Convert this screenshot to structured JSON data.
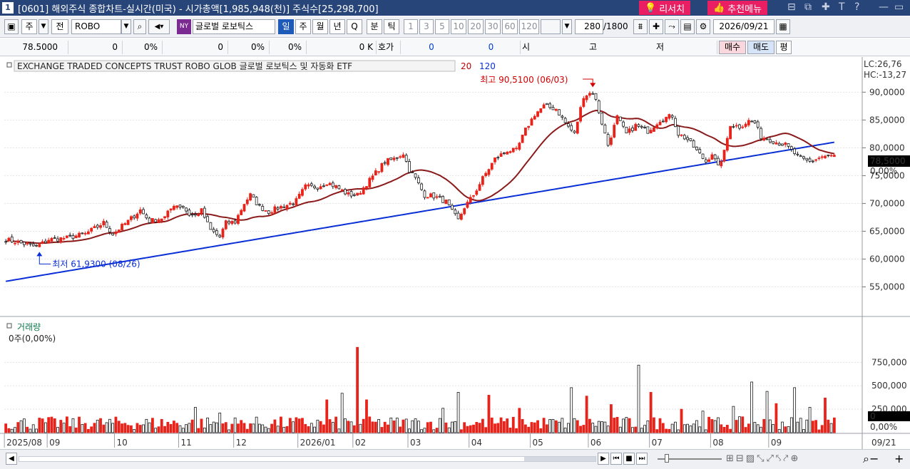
{
  "window": {
    "number": "1",
    "title": "[0601] 해외주식 종합차트-실시간(미국) - 시가총액[1,985,948(천)] 주식수[25,298,700]",
    "research_label": "리서치",
    "recommend_label": "추천메뉴",
    "controls": [
      "⊟",
      "⧉",
      "✚",
      "T",
      "?",
      "—",
      "▭"
    ]
  },
  "toolbar": {
    "period_labels": [
      "주",
      "전"
    ],
    "symbol": "ROBO",
    "market_badge": "NY",
    "stock_name": "글로벌 로보틱스",
    "intervals": [
      "일",
      "주",
      "월",
      "년",
      "Q"
    ],
    "minute_labels": [
      "분",
      "틱"
    ],
    "minute_values": [
      "1",
      "3",
      "5",
      "10",
      "20",
      "30",
      "60",
      "120"
    ],
    "count": "280",
    "count_total": "/1800",
    "date": "2026/09/21"
  },
  "quote": {
    "price": "78.5000",
    "change": "0",
    "change_pct": "0%",
    "volume": "0",
    "vol_pct": "0%",
    "vol_pct2": "0%",
    "amount": "0 K",
    "hoga_label": "호가",
    "hoga_bid": "0",
    "hoga_ask": "0",
    "open_label": "시",
    "high_label": "고",
    "low_label": "저",
    "buy_label": "매수",
    "sell_label": "매도",
    "avg_label": "평"
  },
  "chart_data": {
    "type": "candlestick",
    "title": "EXCHANGE TRADED CONCEPTS TRUST ROBO GLOB  글로벌 로보틱스 및 자동화 ETF",
    "ma_labels": [
      "20",
      "120"
    ],
    "ma_colors": [
      "#8b1a1a",
      "#0a2fd6"
    ],
    "ylim": [
      52500,
      93500
    ],
    "y_ticks": [
      "90,0000",
      "85,0000",
      "80,0000",
      "75,0000",
      "70,0000",
      "65,0000",
      "60,0000",
      "55,0000"
    ],
    "current_price": "78,5000",
    "current_change": "0,00%",
    "lc_label": "LC:26,76",
    "hc_label": "HC:-13,27",
    "high_annotation": "최고 90,5100 (06/03)",
    "low_annotation": "최저 61,9300 (08/26)",
    "x_labels": [
      "2025/08",
      "09",
      "10",
      "11",
      "12",
      "2026/01",
      "02",
      "03",
      "04",
      "05",
      "06",
      "07",
      "08",
      "09"
    ],
    "date_end_label": "09/21",
    "price_path": [
      [
        0,
        63.5
      ],
      [
        4,
        63.0
      ],
      [
        10,
        62.2
      ],
      [
        14,
        63.5
      ],
      [
        20,
        63.8
      ],
      [
        26,
        64.5
      ],
      [
        32,
        66.5
      ],
      [
        35,
        64.5
      ],
      [
        40,
        66.8
      ],
      [
        44,
        68.8
      ],
      [
        47,
        66.8
      ],
      [
        52,
        67.5
      ],
      [
        55,
        69.8
      ],
      [
        58,
        69.4
      ],
      [
        60,
        68.0
      ],
      [
        62,
        67.8
      ],
      [
        64,
        68.7
      ],
      [
        67,
        65.2
      ],
      [
        70,
        64.0
      ],
      [
        72,
        66.5
      ],
      [
        75,
        66.7
      ],
      [
        78,
        70.0
      ],
      [
        80,
        71.5
      ],
      [
        83,
        69.4
      ],
      [
        86,
        68.5
      ],
      [
        89,
        69.2
      ],
      [
        92,
        69.7
      ],
      [
        95,
        70.5
      ],
      [
        98,
        73.0
      ],
      [
        102,
        73.0
      ],
      [
        105,
        73.8
      ],
      [
        108,
        73.0
      ],
      [
        112,
        71.6
      ],
      [
        115,
        71.5
      ],
      [
        118,
        73.5
      ],
      [
        121,
        75.5
      ],
      [
        124,
        77.5
      ],
      [
        127,
        78.0
      ],
      [
        130,
        79.0
      ],
      [
        132,
        76.0
      ],
      [
        134,
        74.5
      ],
      [
        137,
        71.5
      ],
      [
        140,
        71.3
      ],
      [
        144,
        70.3
      ],
      [
        146,
        68.5
      ],
      [
        148,
        67.0
      ],
      [
        150,
        69.3
      ],
      [
        153,
        71.5
      ],
      [
        156,
        74.5
      ],
      [
        160,
        78.0
      ],
      [
        164,
        79.5
      ],
      [
        167,
        79.5
      ],
      [
        170,
        83.2
      ],
      [
        173,
        86.0
      ],
      [
        176,
        87.5
      ],
      [
        180,
        87.0
      ],
      [
        183,
        84.5
      ],
      [
        186,
        82.5
      ],
      [
        189,
        89.3
      ],
      [
        192,
        90.0
      ],
      [
        193,
        88.5
      ],
      [
        195,
        84.5
      ],
      [
        197,
        80.5
      ],
      [
        200,
        85.5
      ],
      [
        203,
        82.5
      ],
      [
        206,
        84.0
      ],
      [
        210,
        83.0
      ],
      [
        214,
        85.0
      ],
      [
        218,
        85.8
      ],
      [
        220,
        82.5
      ],
      [
        223,
        81.5
      ],
      [
        226,
        79.5
      ],
      [
        229,
        77.5
      ],
      [
        231,
        79.0
      ],
      [
        233,
        76.5
      ],
      [
        235,
        79.2
      ],
      [
        237,
        84.2
      ],
      [
        240,
        83.8
      ],
      [
        243,
        84.8
      ],
      [
        245,
        84.5
      ],
      [
        247,
        82.0
      ],
      [
        250,
        81.5
      ],
      [
        252,
        81.0
      ],
      [
        255,
        80.5
      ],
      [
        258,
        79.0
      ],
      [
        260,
        78.0
      ],
      [
        263,
        77.5
      ],
      [
        267,
        78.4
      ],
      [
        270,
        78.5
      ]
    ],
    "volume": {
      "max_label": "750,000",
      "y_ticks": [
        "750,000",
        "500,000",
        "250,000"
      ],
      "ylim": [
        0,
        950000
      ],
      "label": "거래량",
      "current": "0주(0,00%)",
      "current_value": "0",
      "current_pct": "0,00%",
      "spikes": [
        [
          62,
          270000
        ],
        [
          70,
          210000
        ],
        [
          105,
          350000
        ],
        [
          110,
          420000
        ],
        [
          115,
          910000
        ],
        [
          118,
          350000
        ],
        [
          143,
          260000
        ],
        [
          148,
          430000
        ],
        [
          158,
          400000
        ],
        [
          168,
          260000
        ],
        [
          185,
          480000
        ],
        [
          190,
          390000
        ],
        [
          198,
          300000
        ],
        [
          207,
          720000
        ],
        [
          211,
          430000
        ],
        [
          221,
          250000
        ],
        [
          228,
          230000
        ],
        [
          238,
          280000
        ],
        [
          244,
          540000
        ],
        [
          249,
          440000
        ],
        [
          252,
          310000
        ],
        [
          258,
          480000
        ],
        [
          263,
          270000
        ],
        [
          268,
          370000
        ]
      ]
    },
    "high_index": 192,
    "low_index": 11,
    "bars": 272
  },
  "footer_icons": [
    "▶",
    "⏮",
    "■",
    "⏭",
    "zoom-slider",
    "+",
    "−",
    "🔍"
  ]
}
